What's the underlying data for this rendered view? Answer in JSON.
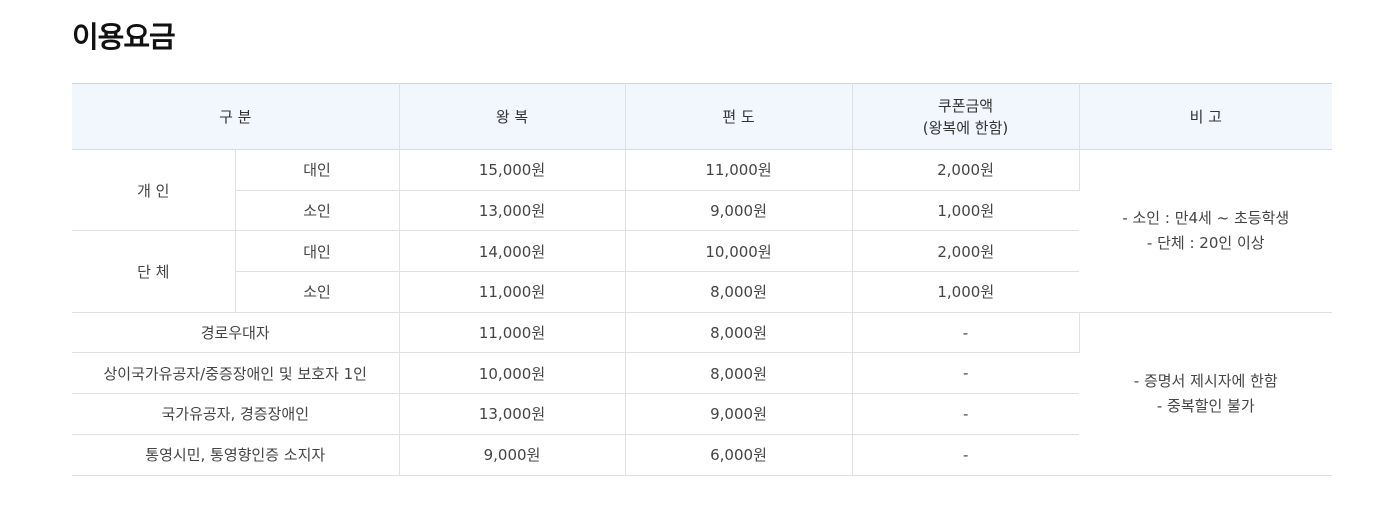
{
  "page_title": "이용요금",
  "headers": {
    "category": "구 분",
    "round_trip": "왕 복",
    "one_way": "편 도",
    "coupon_line1": "쿠폰금액",
    "coupon_line2": "(왕복에 한함)",
    "remarks": "비 고"
  },
  "groups": {
    "individual": {
      "label": "개 인",
      "adult": {
        "label": "대인",
        "round_trip": "15,000원",
        "one_way": "11,000원",
        "coupon": "2,000원"
      },
      "child": {
        "label": "소인",
        "round_trip": "13,000원",
        "one_way": "9,000원",
        "coupon": "1,000원"
      }
    },
    "group": {
      "label": "단 체",
      "adult": {
        "label": "대인",
        "round_trip": "14,000원",
        "one_way": "10,000원",
        "coupon": "2,000원"
      },
      "child": {
        "label": "소인",
        "round_trip": "11,000원",
        "one_way": "8,000원",
        "coupon": "1,000원"
      }
    }
  },
  "remarks_1": {
    "line1": "- 소인 : 만4세 ~ 초등학생",
    "line2": "- 단체 : 20인 이상"
  },
  "discount_rows": [
    {
      "label": "경로우대자",
      "round_trip": "11,000원",
      "one_way": "8,000원",
      "coupon": "-"
    },
    {
      "label": "상이국가유공자/중증장애인 및 보호자 1인",
      "round_trip": "10,000원",
      "one_way": "8,000원",
      "coupon": "-"
    },
    {
      "label": "국가유공자, 경증장애인",
      "round_trip": "13,000원",
      "one_way": "9,000원",
      "coupon": "-"
    },
    {
      "label": "통영시민, 통영향인증 소지자",
      "round_trip": "9,000원",
      "one_way": "6,000원",
      "coupon": "-"
    }
  ],
  "remarks_2": {
    "line1": "- 증명서 제시자에 한함",
    "line2": "- 중복할인 불가"
  },
  "colors": {
    "header_bg": "#f2f6fd",
    "border": "#e0e0e0",
    "title": "#111111"
  }
}
